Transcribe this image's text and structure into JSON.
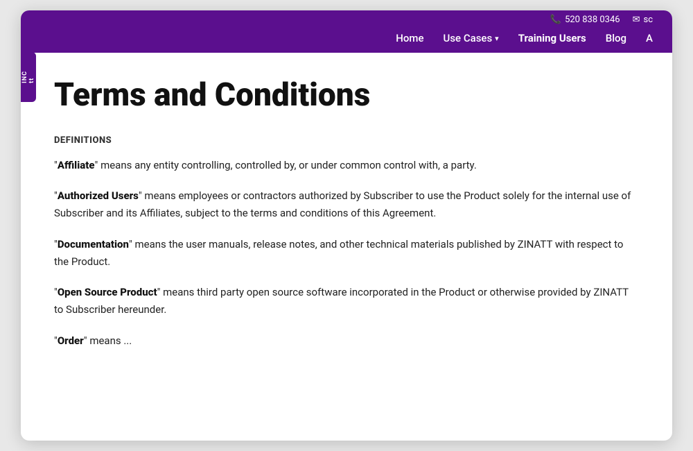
{
  "header": {
    "background_color": "#5b0f8e",
    "contact": {
      "phone": "520 838 0346",
      "email_prefix": "sc"
    },
    "nav": {
      "items": [
        {
          "label": "Home",
          "active": false,
          "has_dropdown": false
        },
        {
          "label": "Use Cases",
          "active": false,
          "has_dropdown": true
        },
        {
          "label": "Training Users",
          "active": true,
          "has_dropdown": false
        },
        {
          "label": "Blog",
          "active": false,
          "has_dropdown": false
        },
        {
          "label": "A",
          "active": false,
          "has_dropdown": false
        }
      ]
    }
  },
  "left_tab": {
    "text": "INC tt"
  },
  "main": {
    "page_title": "Terms and Conditions",
    "section_label": "DEFINITIONS",
    "definitions": [
      {
        "term": "Affiliate",
        "definition": " means any entity controlling, controlled by, or under common control with, a party."
      },
      {
        "term": "Authorized Users",
        "definition": " means employees or contractors authorized by Subscriber to use the Product solely for the internal use of Subscriber and its Affiliates, subject to the terms and conditions of this Agreement."
      },
      {
        "term": "Documentation",
        "definition": " means the user manuals, release notes, and other technical materials published by ZINATT with respect to the Product."
      },
      {
        "term": "Open Source Product",
        "definition": " means third party open source software incorporated in the Product or otherwise provided by ZINATT to Subscriber hereunder."
      },
      {
        "term": "Order",
        "definition": " means ..."
      }
    ]
  }
}
